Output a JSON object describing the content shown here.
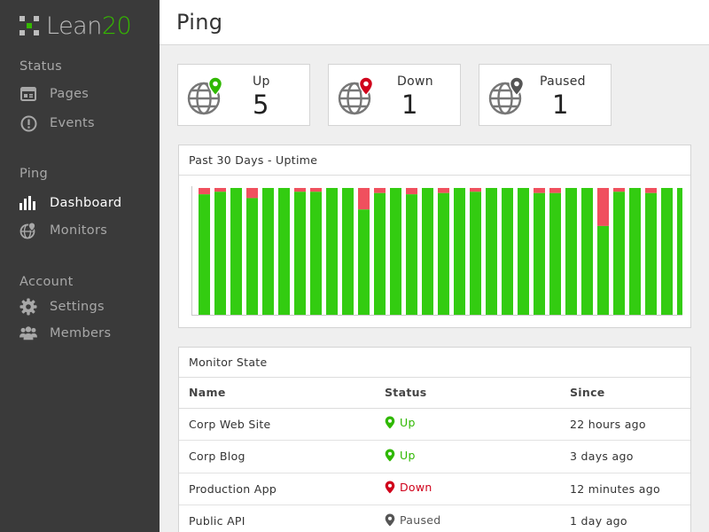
{
  "brand": {
    "name_text": "Lean",
    "name_num": "20",
    "accent": "#35b800"
  },
  "page_title": "Ping",
  "sidebar": {
    "sections": [
      {
        "heading": "Status",
        "items": [
          {
            "label": "Pages",
            "icon": "pages-icon"
          },
          {
            "label": "Events",
            "icon": "alert-circle-icon"
          }
        ]
      },
      {
        "heading": "Ping",
        "items": [
          {
            "label": "Dashboard",
            "icon": "bar-chart-icon",
            "active": true
          },
          {
            "label": "Monitors",
            "icon": "globe-pin-icon"
          }
        ]
      },
      {
        "heading": "Account",
        "items": [
          {
            "label": "Settings",
            "icon": "gear-icon"
          },
          {
            "label": "Members",
            "icon": "users-icon"
          }
        ]
      }
    ]
  },
  "stats": [
    {
      "label": "Up",
      "value": "5",
      "color": "#2fb800"
    },
    {
      "label": "Down",
      "value": "1",
      "color": "#d0021b"
    },
    {
      "label": "Paused",
      "value": "1",
      "color": "#555555"
    }
  ],
  "uptime": {
    "title": "Past 30 Days - Uptime",
    "up_color": "#33cc11",
    "down_color": "#f0505e",
    "chart_data": {
      "type": "bar",
      "days": 30,
      "uptime_pct": [
        95,
        97,
        100,
        92,
        100,
        100,
        97,
        97,
        100,
        100,
        83,
        96,
        100,
        95,
        100,
        96,
        100,
        97,
        100,
        100,
        100,
        96,
        96,
        100,
        100,
        70,
        97,
        100,
        96,
        100,
        100
      ],
      "ylim": [
        0,
        100
      ]
    }
  },
  "monitor_state": {
    "title": "Monitor State",
    "columns": [
      "Name",
      "Status",
      "Since"
    ],
    "rows": [
      {
        "name": "Corp Web Site",
        "status": "Up",
        "status_color": "#2fb800",
        "since": "22 hours ago"
      },
      {
        "name": "Corp Blog",
        "status": "Up",
        "status_color": "#2fb800",
        "since": "3 days ago"
      },
      {
        "name": "Production App",
        "status": "Down",
        "status_color": "#d0021b",
        "since": "12 minutes ago"
      },
      {
        "name": "Public API",
        "status": "Paused",
        "status_color": "#555555",
        "since": "1 day ago"
      }
    ]
  }
}
